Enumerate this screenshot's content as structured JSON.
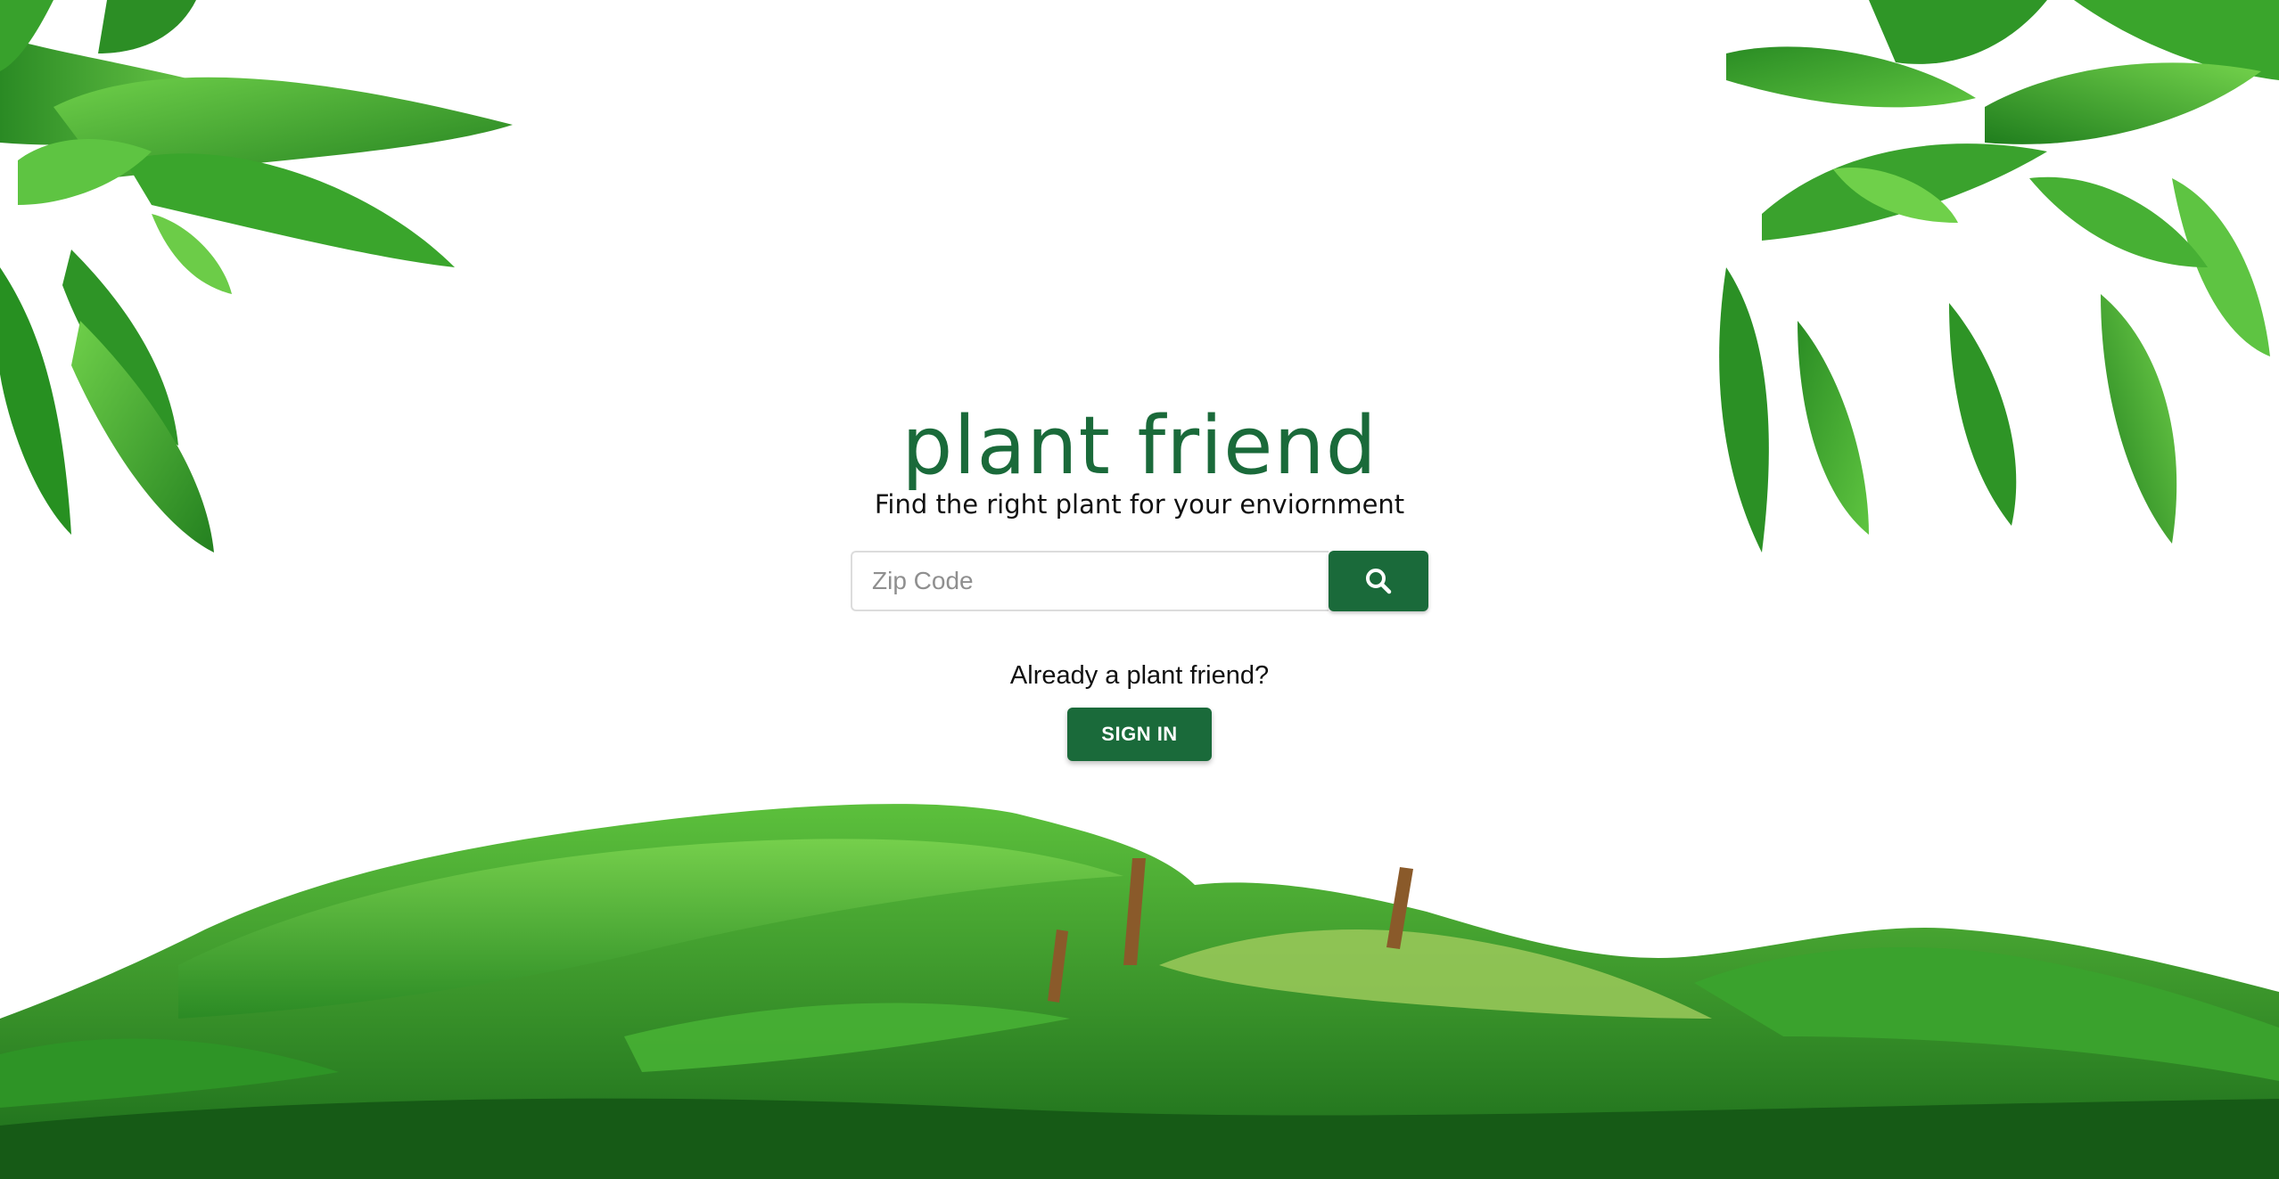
{
  "brand": {
    "title": "plant friend",
    "tagline": "Find the right plant for your enviornment"
  },
  "search": {
    "placeholder": "Zip Code",
    "value": "",
    "button_icon": "search-icon"
  },
  "signin": {
    "prompt": "Already a plant friend?",
    "button_label": "SIGN IN"
  },
  "colors": {
    "brand_green": "#1a6a3a",
    "leaf_light": "#5bbf3a",
    "leaf_mid": "#2f9a2a",
    "leaf_dark": "#1d6b1c"
  }
}
